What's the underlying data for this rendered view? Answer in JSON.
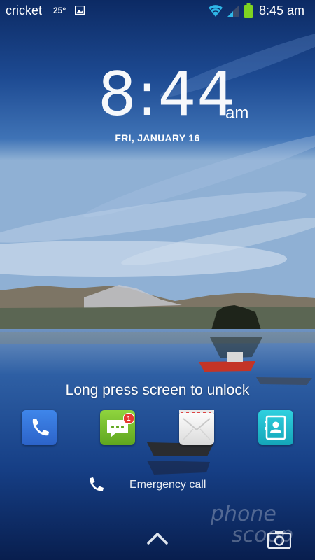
{
  "status_bar": {
    "carrier": "cricket",
    "temperature": "25°",
    "time": "8:45 am",
    "icons": [
      "gallery-icon",
      "wifi-icon",
      "signal-icon",
      "battery-icon"
    ]
  },
  "lock_screen": {
    "clock_time": "8:44",
    "clock_ampm": "am",
    "date": "FRI, JANUARY 16",
    "unlock_hint": "Long press screen to unlock",
    "emergency_call": "Emergency call"
  },
  "dock": {
    "apps": [
      "phone-app",
      "messaging-app",
      "email-app",
      "contacts-app"
    ],
    "messaging_badge": "1"
  },
  "watermark": {
    "line1": "phone",
    "line2": "scoop"
  },
  "colors": {
    "phone": "#2f6fdb",
    "messaging": "#78c12d",
    "contacts": "#1fbccc",
    "badge": "#e53a32",
    "wifi": "#2fb7e8",
    "battery": "#7ed321"
  }
}
